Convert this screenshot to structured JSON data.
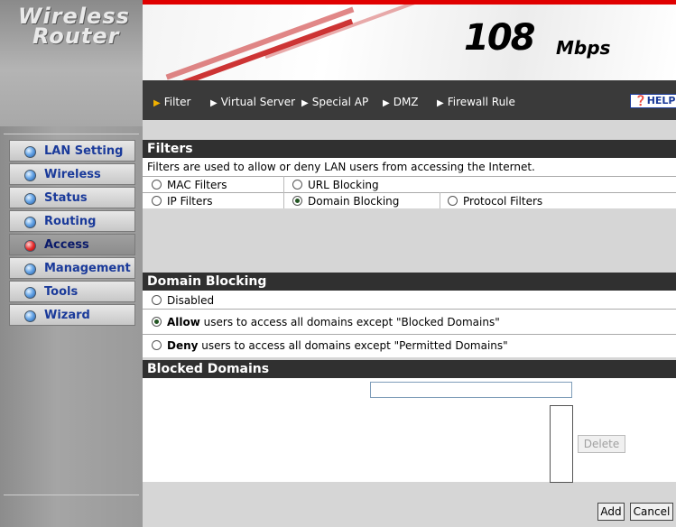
{
  "brand": {
    "line1": "Wireless",
    "line2": "Router"
  },
  "header": {
    "speed": "108",
    "unit": "Mbps"
  },
  "nav": {
    "items": [
      "Filter",
      "Virtual Server",
      "Special AP",
      "DMZ",
      "Firewall Rule"
    ],
    "help": "HELP"
  },
  "sidebar": {
    "items": [
      {
        "label": "LAN Setting",
        "icon": "blue-bullet-icon"
      },
      {
        "label": "Wireless",
        "icon": "blue-bullet-icon"
      },
      {
        "label": "Status",
        "icon": "blue-bullet-icon"
      },
      {
        "label": "Routing",
        "icon": "blue-bullet-icon"
      },
      {
        "label": "Access",
        "icon": "red-bullet-icon",
        "active": true
      },
      {
        "label": "Management",
        "icon": "blue-bullet-icon"
      },
      {
        "label": "Tools",
        "icon": "blue-bullet-icon"
      },
      {
        "label": "Wizard",
        "icon": "blue-bullet-icon"
      }
    ]
  },
  "filters": {
    "title": "Filters",
    "description": "Filters are used to allow or deny LAN users from accessing the Internet.",
    "options": {
      "mac": "MAC Filters",
      "url": "URL Blocking",
      "ip": "IP Filters",
      "domain": "Domain Blocking",
      "protocol": "Protocol Filters"
    },
    "selected": "Domain Blocking"
  },
  "domain_blocking": {
    "title": "Domain Blocking",
    "disabled": "Disabled",
    "allow_bold": "Allow",
    "allow_rest": " users to access all domains except \"Blocked Domains\"",
    "deny_bold": "Deny",
    "deny_rest": " users to access all domains except \"Permitted Domains\"",
    "selected": "Allow"
  },
  "blocked_domains": {
    "title": "Blocked Domains",
    "input_value": "",
    "delete_label": "Delete"
  },
  "actions": {
    "add": "Add",
    "cancel": "Cancel"
  },
  "colors": {
    "frame": "#e00000",
    "bar": "#303030",
    "nav": "#3a3a3a",
    "menu_text": "#1a3a9a"
  }
}
